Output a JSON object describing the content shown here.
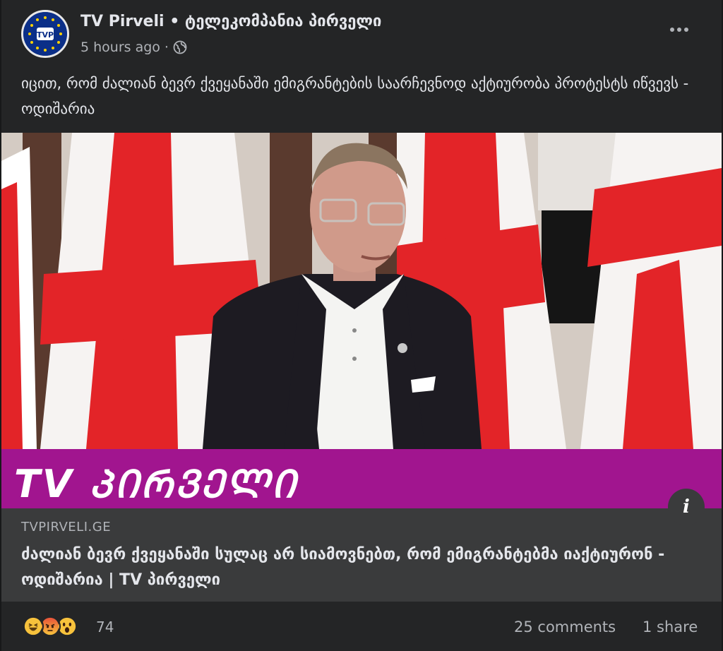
{
  "post": {
    "page_name": "TV Pirveli • ტელეკომპანია პირველი",
    "timestamp": "5 hours ago",
    "separator": "·",
    "privacy_icon": "globe-icon",
    "caption": "იცით, რომ ძალიან ბევრ ქვეყანაში ემიგრანტების საარჩევნოდ აქტიურობა პროტესტს იწვევს - ოდიშარია",
    "avatar_logo_text": "TVP"
  },
  "image": {
    "brand_text": "TV ᲞᲘᲠᲕᲔᲚᲘ",
    "brand_color": "#a1158f"
  },
  "link": {
    "domain": "TVPIRVELI.GE",
    "title": "ძალიან ბევრ ქვეყანაში სულაც არ სიამოვნებთ, რომ ემიგრანტებმა იაქტიურონ - ოდიშარია | TV პირველი",
    "info_label": "i"
  },
  "footer": {
    "reaction_icons": [
      "haha-emoji-icon",
      "angry-emoji-icon",
      "wow-emoji-icon"
    ],
    "reaction_count": "74",
    "comments": "25 comments",
    "shares": "1 share"
  }
}
